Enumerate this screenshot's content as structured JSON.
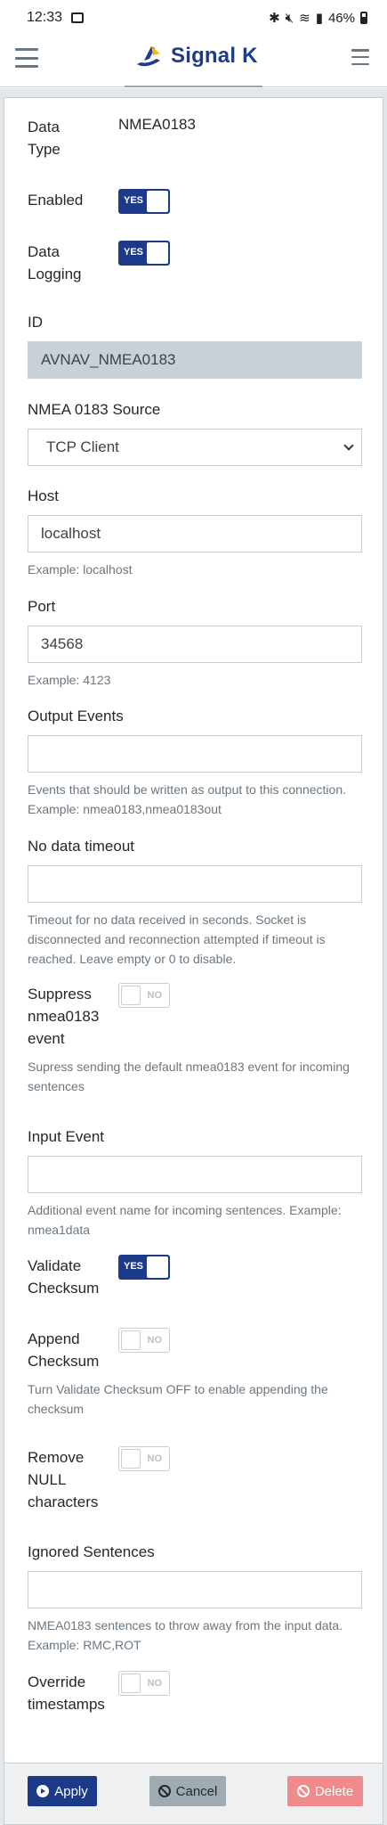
{
  "status_bar": {
    "time": "12:33",
    "battery": "46%"
  },
  "header": {
    "brand": "Signal K"
  },
  "form": {
    "data_type": {
      "label": "Data Type",
      "value": "NMEA0183"
    },
    "enabled": {
      "label": "Enabled",
      "state": "YES"
    },
    "data_logging": {
      "label": "Data Logging",
      "state": "YES"
    },
    "id": {
      "label": "ID",
      "value": "AVNAV_NMEA0183"
    },
    "source": {
      "label": "NMEA 0183 Source",
      "value": "TCP Client"
    },
    "host": {
      "label": "Host",
      "value": "localhost",
      "help": "Example: localhost"
    },
    "port": {
      "label": "Port",
      "value": "34568",
      "help": "Example: 4123"
    },
    "output_events": {
      "label": "Output Events",
      "value": "",
      "help": "Events that should be written as output to this connection. Example: nmea0183,nmea0183out"
    },
    "no_data_timeout": {
      "label": "No data timeout",
      "value": "",
      "help": "Timeout for no data received in seconds. Socket is disconnected and reconnection attempted if timeout is reached. Leave empty or 0 to disable."
    },
    "suppress_event": {
      "label": "Suppress nmea0183 event",
      "state": "NO",
      "help": "Supress sending the default nmea0183 event for incoming sentences"
    },
    "input_event": {
      "label": "Input Event",
      "value": "",
      "help": "Additional event name for incoming sentences. Example: nmea1data"
    },
    "validate_checksum": {
      "label": "Validate Checksum",
      "state": "YES"
    },
    "append_checksum": {
      "label": "Append Checksum",
      "state": "NO",
      "help": "Turn Validate Checksum OFF to enable appending the checksum"
    },
    "remove_null": {
      "label": "Remove NULL characters",
      "state": "NO"
    },
    "ignored_sentences": {
      "label": "Ignored Sentences",
      "value": "",
      "help": "NMEA0183 sentences to throw away from the input data. Example: RMC,ROT"
    },
    "override_timestamps": {
      "label": "Override timestamps",
      "state": "NO"
    }
  },
  "footer": {
    "apply": "Apply",
    "cancel": "Cancel",
    "delete": "Delete"
  },
  "colors": {
    "primary": "#1d3a8a",
    "cancel": "#9fabb3",
    "danger": "#f18a8a"
  }
}
